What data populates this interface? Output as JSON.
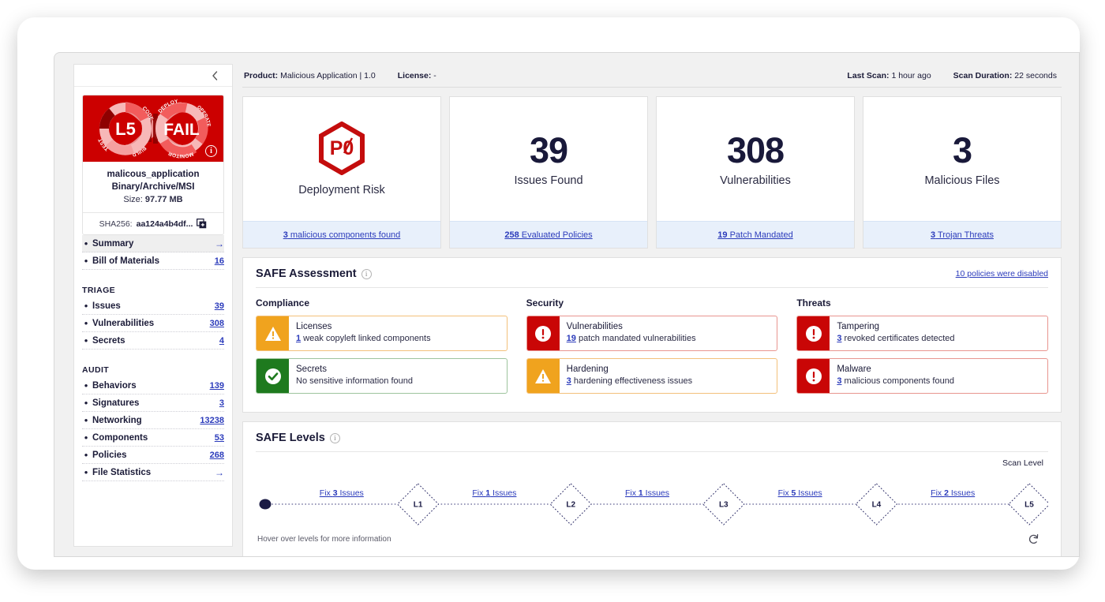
{
  "sidebar": {
    "collapse_icon": "chevron-left-icon",
    "badge": {
      "level": "L5",
      "status": "FAIL",
      "ring_left": [
        "BUILD",
        "CODE",
        "TEST"
      ],
      "ring_right": [
        "DEPLOY",
        "OPERATE",
        "MONITOR"
      ],
      "info_icon": "info-icon",
      "bg_color": "#cc0000"
    },
    "artifact": {
      "name": "malicous_application",
      "type": "Binary/Archive/MSI",
      "size_label": "Size:",
      "size_value": "97.77 MB",
      "hash_label": "SHA256:",
      "hash_value": "aa124a4b4df...",
      "copy_icon": "copy-icon"
    },
    "groups": [
      {
        "header": "",
        "items": [
          {
            "label": "Summary",
            "value": "",
            "arrow": "→",
            "active": true
          },
          {
            "label": "Bill of Materials",
            "value": "16",
            "arrow": "",
            "active": false
          }
        ]
      },
      {
        "header": "TRIAGE",
        "items": [
          {
            "label": "Issues",
            "value": "39",
            "arrow": "",
            "active": false
          },
          {
            "label": "Vulnerabilities",
            "value": "308",
            "arrow": "",
            "active": false
          },
          {
            "label": "Secrets",
            "value": "4",
            "arrow": "",
            "active": false
          }
        ]
      },
      {
        "header": "AUDIT",
        "items": [
          {
            "label": "Behaviors",
            "value": "139",
            "arrow": "",
            "active": false
          },
          {
            "label": "Signatures",
            "value": "3",
            "arrow": "",
            "active": false
          },
          {
            "label": "Networking",
            "value": "13238",
            "arrow": "",
            "active": false
          },
          {
            "label": "Components",
            "value": "53",
            "arrow": "",
            "active": false
          },
          {
            "label": "Policies",
            "value": "268",
            "arrow": "",
            "active": false
          },
          {
            "label": "File Statistics",
            "value": "",
            "arrow": "→",
            "active": false
          }
        ]
      }
    ]
  },
  "topbar": {
    "product_label": "Product:",
    "product_value": "Malicious Application | 1.0",
    "license_label": "License:",
    "license_value": "-",
    "last_scan_label": "Last Scan:",
    "last_scan_value": "1 hour ago",
    "scan_duration_label": "Scan Duration:",
    "scan_duration_value": "22 seconds"
  },
  "kpis": [
    {
      "icon": "p0-hexagon-icon",
      "value": "",
      "label": "Deployment Risk",
      "footer_count": "3",
      "footer_text": " malicious components found"
    },
    {
      "icon": "",
      "value": "39",
      "label": "Issues Found",
      "footer_count": "258",
      "footer_text": " Evaluated Policies"
    },
    {
      "icon": "",
      "value": "308",
      "label": "Vulnerabilities",
      "footer_count": "19",
      "footer_text": " Patch Mandated"
    },
    {
      "icon": "",
      "value": "3",
      "label": "Malicious Files",
      "footer_count": "3",
      "footer_text": " Trojan Threats"
    }
  ],
  "assessment": {
    "title": "SAFE Assessment",
    "info_icon": "info-icon",
    "disabled_link": "10 policies were disabled",
    "columns": [
      {
        "title": "Compliance",
        "cards": [
          {
            "severity": "warn",
            "icon": "warning-triangle-icon",
            "title": "Licenses",
            "count": "1",
            "sub": " weak copyleft linked components"
          },
          {
            "severity": "ok",
            "icon": "check-circle-icon",
            "title": "Secrets",
            "count": "",
            "sub": "No sensitive information found"
          }
        ]
      },
      {
        "title": "Security",
        "cards": [
          {
            "severity": "crit",
            "icon": "exclamation-circle-icon",
            "title": "Vulnerabilities",
            "count": "19",
            "sub": " patch mandated vulnerabilities"
          },
          {
            "severity": "warn",
            "icon": "warning-triangle-icon",
            "title": "Hardening",
            "count": "3",
            "sub": " hardening effectiveness issues"
          }
        ]
      },
      {
        "title": "Threats",
        "cards": [
          {
            "severity": "crit",
            "icon": "exclamation-circle-icon",
            "title": "Tampering",
            "count": "3",
            "sub": " revoked certificates detected"
          },
          {
            "severity": "crit",
            "icon": "exclamation-circle-icon",
            "title": "Malware",
            "count": "3",
            "sub": " malicious components found"
          }
        ]
      }
    ]
  },
  "levels": {
    "title": "SAFE Levels",
    "info_icon": "info-icon",
    "scan_level_label": "Scan Level",
    "hover_hint": "Hover over levels for more information",
    "reset_icon": "refresh-ccw-icon",
    "nodes": [
      "L1",
      "L2",
      "L3",
      "L4",
      "L5"
    ],
    "segments": [
      "Fix 3 Issues",
      "Fix 1 Issues",
      "Fix 1 Issues",
      "Fix 5 Issues",
      "Fix 2 Issues"
    ],
    "segment_counts": [
      "3",
      "1",
      "1",
      "5",
      "2"
    ]
  },
  "colors": {
    "critical": "#c90606",
    "warning": "#f0a31e",
    "ok": "#1e7a1e",
    "link": "#2b3bbb",
    "badge_bg": "#cc0000"
  }
}
